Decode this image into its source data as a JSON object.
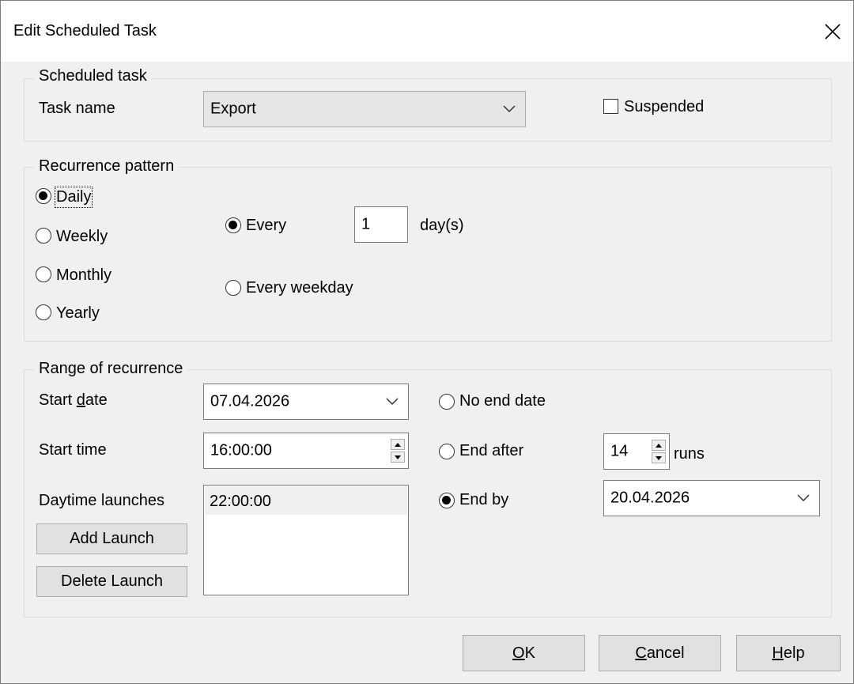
{
  "dialog": {
    "title": "Edit Scheduled Task"
  },
  "scheduled_task": {
    "legend": "Scheduled task",
    "task_name_label": "Task name",
    "task_name_value": "Export",
    "suspended_label": "Suspended",
    "suspended_checked": false
  },
  "recurrence": {
    "legend": "Recurrence pattern",
    "options": [
      "Daily",
      "Weekly",
      "Monthly",
      "Yearly"
    ],
    "selected": "Daily",
    "every_label": "Every",
    "every_value": "1",
    "days_label": "day(s)",
    "every_weekday_label": "Every weekday"
  },
  "range": {
    "legend": "Range of recurrence",
    "start_date_label_pre": "Start ",
    "start_date_label_u": "d",
    "start_date_label_post": "ate",
    "start_date_value": "07.04.2026",
    "start_time_label": "Start time",
    "start_time_value": "16:00:00",
    "daytime_launches_label": "Daytime launches",
    "launches": [
      "22:00:00"
    ],
    "add_launch_label": "Add Launch",
    "delete_launch_label": "Delete Launch",
    "no_end_date_label": "No end date",
    "end_after_label": "End after",
    "end_after_value": "14",
    "runs_label": "runs",
    "end_by_label": "End by",
    "end_by_value": "20.04.2026",
    "end_selected": "End by"
  },
  "buttons": {
    "ok_u": "O",
    "ok_rest": "K",
    "cancel_u": "C",
    "cancel_rest": "ancel",
    "help_u": "H",
    "help_rest": "elp"
  },
  "icons": {
    "close": "close-icon",
    "chevron": "chevron-down-icon",
    "spin_up": "spin-up-icon",
    "spin_down": "spin-down-icon"
  }
}
